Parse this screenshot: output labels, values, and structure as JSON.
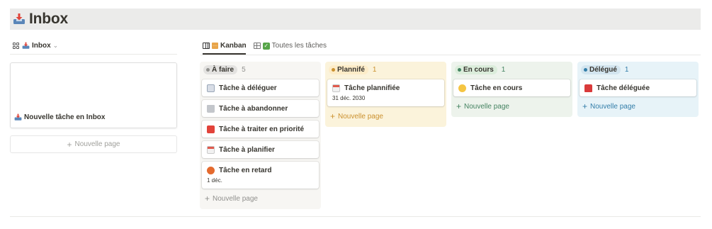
{
  "page": {
    "title": "Inbox"
  },
  "left_panel": {
    "view_label": "Inbox",
    "gallery_card_title": "Nouvelle tâche en Inbox",
    "new_page_label": "Nouvelle page"
  },
  "tabs": [
    {
      "label": "Kanban",
      "active": true
    },
    {
      "label": "Toutes les tâches",
      "active": false
    }
  ],
  "columns": [
    {
      "name": "À faire",
      "count": "5",
      "bg": "#f7f6f3",
      "pill_bg": "#e3e2e0",
      "dot": "#91918e",
      "count_color": "#91918e",
      "new_color": "#91918e",
      "cards": [
        {
          "title": "Tâche à déléguer",
          "icon": "envelope-icon"
        },
        {
          "title": "Tâche à abandonner",
          "icon": "trash-icon"
        },
        {
          "title": "Tâche à traiter en priorité",
          "icon": "priority-icon"
        },
        {
          "title": "Tâche à planifier",
          "icon": "calendar-icon"
        },
        {
          "title": "Tâche en retard",
          "icon": "angry-face-icon",
          "date": "1 déc."
        }
      ],
      "new_page_label": "Nouvelle page"
    },
    {
      "name": "Plannifé",
      "count": "1",
      "bg": "#fbf3db",
      "pill_bg": "#fdecc8",
      "dot": "#cb912f",
      "count_color": "#cb912f",
      "new_color": "#cb912f",
      "cards": [
        {
          "title": "Tâche plannifiée",
          "icon": "calendar-icon",
          "date": "31 déc. 2030"
        }
      ],
      "new_page_label": "Nouvelle page"
    },
    {
      "name": "En cours",
      "count": "1",
      "bg": "#edf3ec",
      "pill_bg": "#dbeddb",
      "dot": "#448361",
      "count_color": "#448361",
      "new_color": "#448361",
      "cards": [
        {
          "title": "Tâche en cours",
          "icon": "thinking-face-icon"
        }
      ],
      "new_page_label": "Nouvelle page"
    },
    {
      "name": "Délégué",
      "count": "1",
      "bg": "#e7f3f8",
      "pill_bg": "#d3e5ef",
      "dot": "#337ea9",
      "count_color": "#337ea9",
      "new_color": "#337ea9",
      "cards": [
        {
          "title": "Tâche déléguée",
          "icon": "mailbox-icon"
        }
      ],
      "new_page_label": "Nouvelle page"
    }
  ]
}
